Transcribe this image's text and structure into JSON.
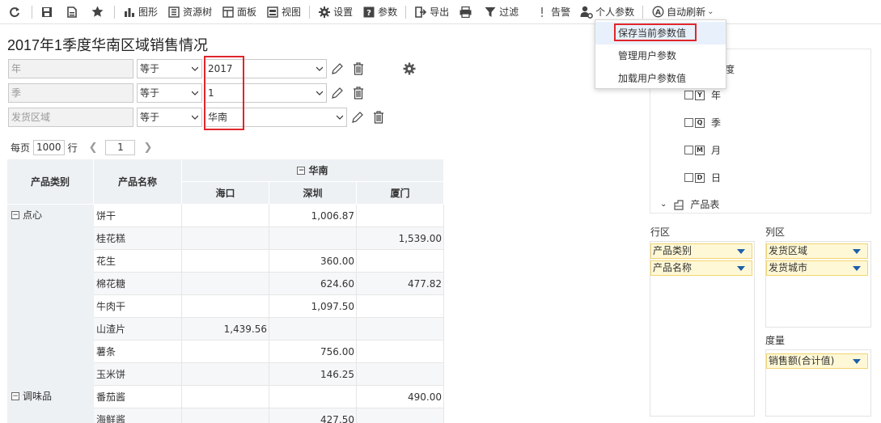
{
  "toolbar": {
    "chart": "图形",
    "resource_tree": "资源树",
    "panel": "面板",
    "view": "视图",
    "settings": "设置",
    "params": "参数",
    "export": "导出",
    "filter": "过滤",
    "alert": "告警",
    "personal_params": "个人参数",
    "auto_refresh": "自动刷新"
  },
  "menu": {
    "items": [
      "保存当前参数值",
      "管理用户参数",
      "加载用户参数值"
    ]
  },
  "title": "2017年1季度华南区域销售情况",
  "filters": [
    {
      "field": "年",
      "op": "等于",
      "value": "2017"
    },
    {
      "field": "季",
      "op": "等于",
      "value": "1"
    },
    {
      "field": "发货区域",
      "op": "等于",
      "value": "华南"
    }
  ],
  "pager": {
    "per_page": "每页",
    "size": "1000",
    "rows": "行",
    "page": "1"
  },
  "table": {
    "h_category": "产品类别",
    "h_name": "产品名称",
    "region": "华南",
    "cities": [
      "海口",
      "深圳",
      "厦门"
    ],
    "categories": [
      "点心",
      "调味品"
    ],
    "rows": [
      {
        "name": "饼干",
        "c1": "",
        "c2": "1,006.87",
        "c3": ""
      },
      {
        "name": "桂花糕",
        "c1": "",
        "c2": "",
        "c3": "1,539.00"
      },
      {
        "name": "花生",
        "c1": "",
        "c2": "360.00",
        "c3": ""
      },
      {
        "name": "棉花糖",
        "c1": "",
        "c2": "624.60",
        "c3": "477.82"
      },
      {
        "name": "牛肉干",
        "c1": "",
        "c2": "1,097.50",
        "c3": ""
      },
      {
        "name": "山渣片",
        "c1": "1,439.56",
        "c2": "",
        "c3": ""
      },
      {
        "name": "薯条",
        "c1": "",
        "c2": "756.00",
        "c3": ""
      },
      {
        "name": "玉米饼",
        "c1": "",
        "c2": "146.25",
        "c3": ""
      },
      {
        "name": "番茄酱",
        "c1": "",
        "c2": "",
        "c3": "490.00"
      },
      {
        "name": "海鲜酱",
        "c1": "",
        "c2": "427.50",
        "c3": ""
      }
    ]
  },
  "right_panel": {
    "tree_partial": "度",
    "date_fields": [
      "年",
      "季",
      "月",
      "日"
    ],
    "date_icons": [
      "Y",
      "Q",
      "M",
      "D"
    ],
    "table_node": "产品表",
    "row_zone": "行区",
    "col_zone": "列区",
    "measure_zone": "度量",
    "row_fields": [
      "产品类别",
      "产品名称"
    ],
    "col_fields": [
      "发货区域",
      "发货城市"
    ],
    "measure_fields": [
      "销售额(合计值)"
    ]
  }
}
